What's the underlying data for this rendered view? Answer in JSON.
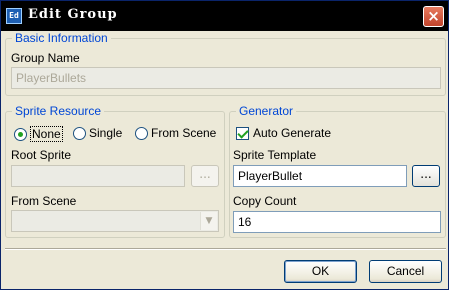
{
  "window": {
    "title": "Edit Group",
    "app_icon_text": "Ed",
    "close_glyph": "×"
  },
  "basic": {
    "legend": "Basic Information",
    "group_name_label": "Group Name",
    "group_name_value": "PlayerBullets"
  },
  "sprite_resource": {
    "legend": "Sprite Resource",
    "options": [
      "None",
      "Single",
      "From Scene"
    ],
    "selected": "None",
    "root_sprite_label": "Root Sprite",
    "root_sprite_value": "",
    "browse_label": "...",
    "from_scene_label": "From Scene",
    "from_scene_value": ""
  },
  "generator": {
    "legend": "Generator",
    "auto_generate_label": "Auto Generate",
    "auto_generate_checked": true,
    "sprite_template_label": "Sprite Template",
    "sprite_template_value": "PlayerBullet",
    "browse_label": "...",
    "copy_count_label": "Copy Count",
    "copy_count_value": "16"
  },
  "buttons": {
    "ok": "OK",
    "cancel": "Cancel"
  }
}
